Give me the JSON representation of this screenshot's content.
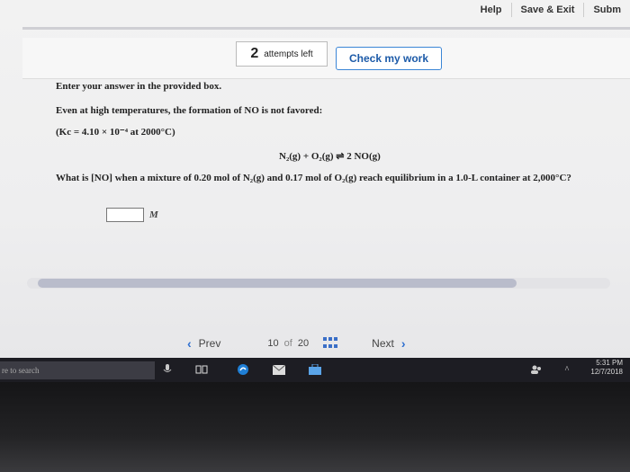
{
  "topnav": {
    "items": [
      "Help",
      "Save & Exit",
      "Subm"
    ]
  },
  "assessment": {
    "attempts_count": "2",
    "attempts_label": "attempts left",
    "check_button": "Check my work"
  },
  "question": {
    "instruction": "Enter your answer in the provided box.",
    "statement": "Even at high temperatures, the formation of NO is not favored:",
    "kc": "(Kc = 4.10 × 10⁻⁴ at 2000°C)",
    "equation": "N₂(g) + O₂(g) ⇌ 2 NO(g)",
    "prompt": "What is [NO] when a mixture of 0.20 mol of N₂(g) and 0.17 mol of O₂(g) reach equilibrium in a 1.0-L container at 2,000°C?",
    "answer_value": "",
    "unit": "M"
  },
  "pager": {
    "prev_label": "Prev",
    "current": "10",
    "of_label": "of",
    "total": "20",
    "next_label": "Next"
  },
  "taskbar": {
    "search_text": "re to search",
    "time": "5:31 PM",
    "date": "12/7/2018"
  }
}
